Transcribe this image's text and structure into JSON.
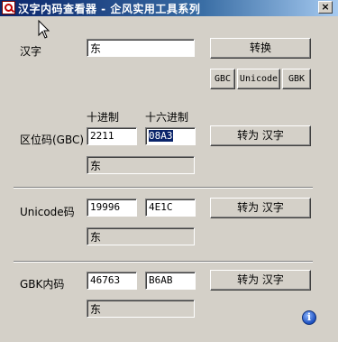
{
  "window": {
    "title": "汉字内码查看器 - 企风实用工具系列",
    "close": "×"
  },
  "hanzi": {
    "label": "汉字",
    "value": "东",
    "convert": "转换"
  },
  "encodings": {
    "gbc": "GBC",
    "unicode": "Unicode",
    "gbk": "GBK"
  },
  "headers": {
    "decimal": "十进制",
    "hex": "十六进制"
  },
  "quwei": {
    "label": "区位码(GBC)",
    "decimal": "2211",
    "hex": "08A3",
    "button": "转为 汉字",
    "result": "东"
  },
  "unicode": {
    "label": "Unicode码",
    "decimal": "19996",
    "hex": "4E1C",
    "button": "转为 汉字",
    "result": "东"
  },
  "gbk": {
    "label": "GBK内码",
    "decimal": "46763",
    "hex": "B6AB",
    "button": "转为 汉字",
    "result": "东"
  },
  "icons": {
    "app": "search-magnifier-icon",
    "info": "info-icon",
    "info_glyph": "i"
  }
}
